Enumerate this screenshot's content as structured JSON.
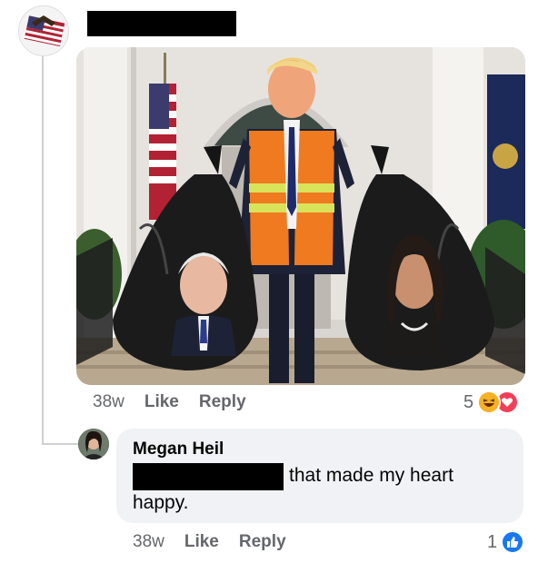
{
  "post_comment": {
    "timestamp": "38w",
    "like_label": "Like",
    "reply_label": "Reply",
    "reaction_count": "5",
    "reaction_icons": [
      "laugh-emoji-icon",
      "love-emoji-icon"
    ]
  },
  "reply_comment": {
    "author": "Megan Heil",
    "text_line1": "that made my heart",
    "text_line2": "happy.",
    "timestamp": "38w",
    "like_label": "Like",
    "reply_label": "Reply",
    "reaction_count": "1",
    "reaction_icons": [
      "like-thumb-icon"
    ]
  },
  "colors": {
    "meta_gray": "#65676b",
    "bubble_bg": "#f0f2f5",
    "like_blue": "#1877f2",
    "love_red": "#f33e58",
    "haha_yellow": "#f7b125"
  }
}
